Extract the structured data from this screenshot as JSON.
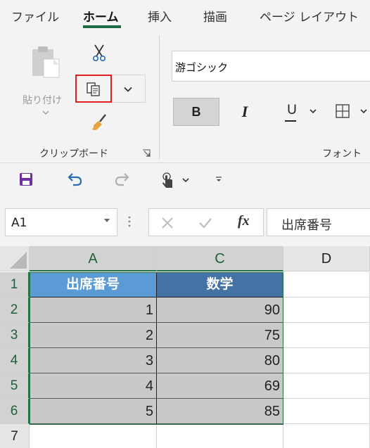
{
  "tabs": [
    {
      "label": "ファイル"
    },
    {
      "label": "ホーム"
    },
    {
      "label": "挿入"
    },
    {
      "label": "描画"
    },
    {
      "label": "ページ レイアウト"
    }
  ],
  "active_tab": "ホーム",
  "ribbon": {
    "clipboard": {
      "paste_label": "貼り付け",
      "group_label": "クリップボード"
    },
    "font": {
      "font_name": "游ゴシック",
      "bold_label": "B",
      "italic_label": "I",
      "underline_label": "U",
      "group_label": "フォント"
    }
  },
  "quick_access": {
    "icons": [
      "save-icon",
      "undo-icon",
      "redo-icon",
      "touch-mode-icon",
      "customize-icon"
    ]
  },
  "formula_bar": {
    "name_box": "A1",
    "fx_label": "fx",
    "formula": "出席番号"
  },
  "sheet": {
    "columns": [
      "A",
      "C",
      "D"
    ],
    "rows": [
      "1",
      "2",
      "3",
      "4",
      "5",
      "6",
      "7"
    ],
    "header_row": {
      "a": "出席番号",
      "c": "数学"
    },
    "data": [
      {
        "a": "1",
        "c": "90"
      },
      {
        "a": "2",
        "c": "75"
      },
      {
        "a": "3",
        "c": "80"
      },
      {
        "a": "4",
        "c": "69"
      },
      {
        "a": "5",
        "c": "85"
      }
    ],
    "colors": {
      "header_a": "#5b9bd5",
      "header_c": "#4472a4",
      "data_fill": "#c9c9c9",
      "selection": "#217346"
    }
  }
}
